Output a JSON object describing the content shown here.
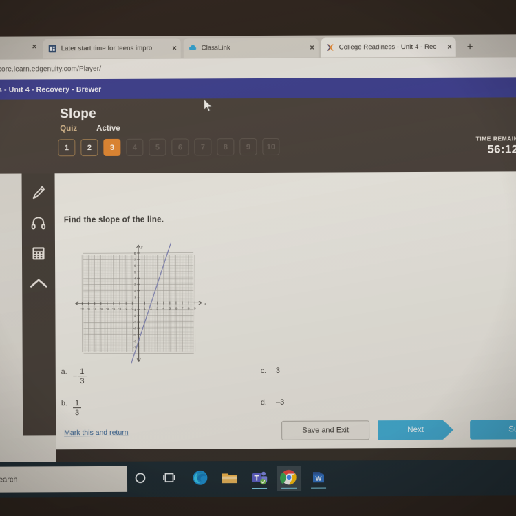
{
  "browser": {
    "tabs": [
      {
        "id": "tab-news",
        "title": "Later start time for teens impro",
        "favicon": "news-favicon",
        "close": "×",
        "active": false
      },
      {
        "id": "tab-classlink",
        "title": "ClassLink",
        "favicon": "classlink-favicon",
        "close": "×",
        "active": false
      },
      {
        "id": "tab-edgenuity",
        "title": "College Readiness - Unit 4 - Rec",
        "favicon": "edgenuity-favicon",
        "close": "×",
        "active": true
      }
    ],
    "leftmost_tab_close": "×",
    "new_tab_label": "+",
    "url": "core.learn.edgenuity.com/Player/"
  },
  "breadcrumb": "s - Unit 4 - Recovery - Brewer",
  "lesson": {
    "title": "Slope",
    "kind_label": "Quiz",
    "status_label": "Active",
    "question_numbers": [
      {
        "n": "1",
        "state": "done"
      },
      {
        "n": "2",
        "state": "done"
      },
      {
        "n": "3",
        "state": "cur"
      },
      {
        "n": "4",
        "state": "locked"
      },
      {
        "n": "5",
        "state": "locked"
      },
      {
        "n": "6",
        "state": "locked"
      },
      {
        "n": "7",
        "state": "locked"
      },
      {
        "n": "8",
        "state": "locked"
      },
      {
        "n": "9",
        "state": "locked"
      },
      {
        "n": "10",
        "state": "locked"
      }
    ],
    "timer_label": "TIME REMAIN",
    "timer_value": "56:12"
  },
  "tools": [
    {
      "id": "highlighter-tool",
      "icon": "pencil-icon"
    },
    {
      "id": "audio-tool",
      "icon": "headphones-icon"
    },
    {
      "id": "calculator-tool",
      "icon": "calculator-icon"
    },
    {
      "id": "collapse-tool",
      "icon": "chevron-up-icon"
    }
  ],
  "question": {
    "prompt": "Find the slope of the line.",
    "choices": [
      {
        "label": "a.",
        "kind": "fraction",
        "negative": true,
        "num": "1",
        "den": "3",
        "text": "-1/3"
      },
      {
        "label": "b.",
        "kind": "fraction",
        "negative": false,
        "num": "1",
        "den": "3",
        "text": "1/3"
      },
      {
        "label": "c.",
        "kind": "plain",
        "text": "3"
      },
      {
        "label": "d.",
        "kind": "plain",
        "text": "–3"
      }
    ]
  },
  "chart_data": {
    "type": "line",
    "title": "",
    "xlabel": "x",
    "ylabel": "y",
    "xlim": [
      -9,
      9
    ],
    "ylim": [
      -8,
      8
    ],
    "grid": true,
    "minor_grid": true,
    "xticks": [
      "-9",
      "-8",
      "-7",
      "-6",
      "-5",
      "-4",
      "-3",
      "-2",
      "-1",
      "1",
      "2",
      "3",
      "4",
      "5",
      "6",
      "7",
      "8",
      "9"
    ],
    "yticks": [
      "8",
      "7",
      "6",
      "5",
      "4",
      "3",
      "2",
      "1",
      "-1",
      "-2",
      "-3",
      "-4",
      "-5",
      "-6",
      "-7"
    ],
    "series": [
      {
        "name": "line",
        "color": "#7b7fb5",
        "slope": 3,
        "intercept": -6,
        "points": [
          [
            0,
            -6
          ],
          [
            2,
            0
          ],
          [
            3,
            3
          ],
          [
            4,
            6
          ]
        ],
        "x_intercept": 2,
        "y_intercept": -6
      }
    ],
    "legend": "none"
  },
  "footer": {
    "mark_link": "Mark this and return",
    "save_label": "Save and Exit",
    "next_label": "Next",
    "submit_label": "Submit"
  },
  "taskbar": {
    "search_text": "earch",
    "items": [
      {
        "id": "cortana",
        "icon": "circle-icon"
      },
      {
        "id": "task-view",
        "icon": "task-view-icon"
      },
      {
        "id": "edge",
        "icon": "edge-icon"
      },
      {
        "id": "file-explorer",
        "icon": "folder-icon"
      },
      {
        "id": "teams",
        "icon": "teams-icon"
      },
      {
        "id": "chrome",
        "icon": "chrome-icon"
      },
      {
        "id": "word",
        "icon": "word-icon"
      }
    ]
  },
  "colors": {
    "accent_orange": "#e8862c",
    "accent_blue": "#3aaed8",
    "header_brown": "#4a423b",
    "nav_blue": "#3b3f96",
    "link_blue": "#2f5f94"
  }
}
